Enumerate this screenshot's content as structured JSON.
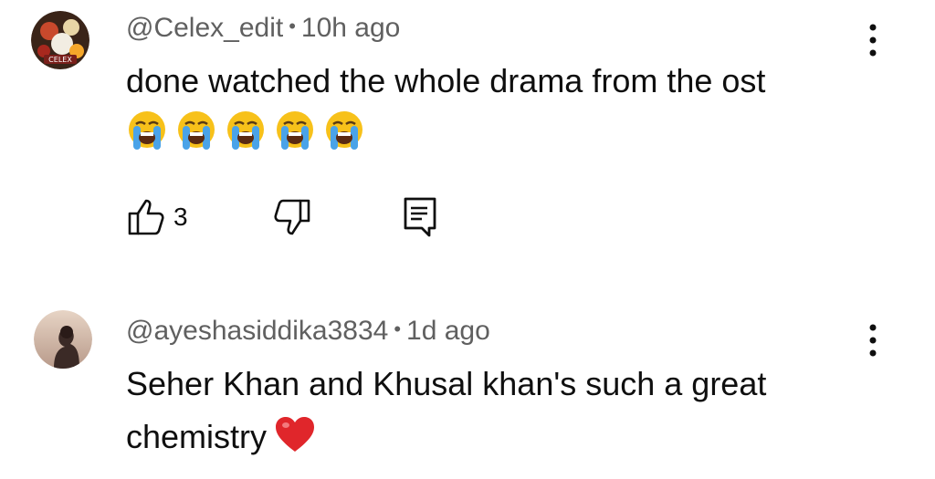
{
  "comments": [
    {
      "handle": "@Celex_edit",
      "separator": "•",
      "time": "10h ago",
      "text": "done watched the whole drama from the ost",
      "emoji_count": 5,
      "emoji_name": "loudly-crying-face",
      "likes": "3",
      "avatar_label": "CELEX"
    },
    {
      "handle": "@ayeshasiddika3834",
      "separator": "•",
      "time": "1d ago",
      "text": "Seher Khan and Khusal khan's such a great chemistry",
      "trailing_emoji": "red-heart"
    }
  ],
  "icons": {
    "like": "thumbs-up-icon",
    "dislike": "thumbs-down-icon",
    "reply": "reply-comment-icon",
    "more": "more-vertical-icon"
  },
  "colors": {
    "text": "#0f0f0f",
    "meta": "#606060",
    "emoji_face": "#f7c11a",
    "tears": "#4aa3e8",
    "heart": "#e0262b"
  }
}
